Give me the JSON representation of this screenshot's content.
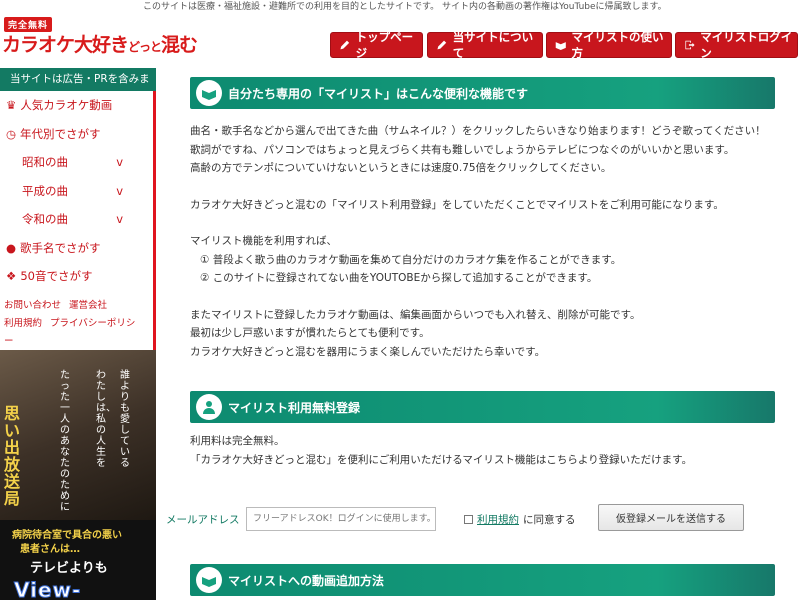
{
  "topnote": "このサイトは医療・福祉施設・避難所での利用を目的としたサイトです。 サイト内の各動画の著作権はYouTubeに帰属致します。",
  "logo": {
    "badge": "完全無料",
    "main": "カラオケ大好き",
    "small": "どっと",
    "tail": "混む"
  },
  "nav": [
    {
      "label": "トップページ",
      "icon": "pen-icon"
    },
    {
      "label": "当サイトについて",
      "icon": "pen-icon"
    },
    {
      "label": "マイリストの使い方",
      "icon": "book-icon"
    },
    {
      "label": "マイリストログイン",
      "icon": "login-icon"
    }
  ],
  "sidebar": {
    "header": "当サイトは広告・PRを含みます",
    "items": [
      {
        "label": "人気カラオケ動画",
        "icon": "crown-icon"
      },
      {
        "label": "年代別でさがす",
        "icon": "clock-icon"
      },
      {
        "label": "昭和の曲",
        "arrow": "v"
      },
      {
        "label": "平成の曲",
        "arrow": "v"
      },
      {
        "label": "令和の曲",
        "arrow": "v"
      },
      {
        "label": "歌手名でさがす",
        "icon": "person-icon"
      },
      {
        "label": "50音でさがす",
        "icon": "speech-icon"
      }
    ],
    "links": [
      "お問い合わせ",
      "運営会社",
      "利用規約",
      "プライバシーポリシー"
    ]
  },
  "ad": {
    "title": "思い出放送局",
    "v1": "たった一人のあなたのために",
    "v2": "わたしは、私の人生を",
    "v3": "誰よりも愛している",
    "t1": "病院待合室で具合の悪い",
    "t2": "患者さんは…",
    "t3": "テレビよりも",
    "t4": "View-TV.Net"
  },
  "main": {
    "sec1_title": "自分たち専用の「マイリスト」はこんな便利な機能です",
    "p1": [
      "曲名・歌手名などから選んで出てきた曲（サムネイル？）をクリックしたらいきなり始まります！どうぞ歌ってください！",
      "歌詞がですね、パソコンではちょっと見えづらく共有も難しいでしょうからテレビにつなぐのがいいかと思います。",
      "高齢の方でテンポについていけないというときには速度0.75倍をクリックしてください。"
    ],
    "p2": "カラオケ大好きどっと混むの「マイリスト利用登録」をしていただくことでマイリストをご利用可能になります。",
    "p3_lead": "マイリスト機能を利用すれば、",
    "p3_items": [
      "① 普段よく歌う曲のカラオケ動画を集めて自分だけのカラオケ集を作ることができます。",
      "② このサイトに登録されてない曲をYOUTOBEから探して追加することができます。"
    ],
    "p4": [
      "またマイリストに登録したカラオケ動画は、編集画面からいつでも入れ替え、削除が可能です。",
      "最初は少し戸惑いますが慣れたらとても便利です。",
      "カラオケ大好きどっと混むを器用にうまく楽しんでいただけたら幸いです。"
    ],
    "sec2_title": "マイリスト利用無料登録",
    "p5": [
      "利用料は完全無料。",
      "「カラオケ大好きどっと混む」を便利にご利用いただけるマイリスト機能はこちらより登録いただけます。"
    ],
    "form": {
      "label": "メールアドレス",
      "placeholder": "フリーアドレスOK！ログインに使用します。",
      "check_link": "利用規約",
      "check_text": "に同意する",
      "button": "仮登録メールを送信する"
    },
    "sec3_title": "マイリストへの動画追加方法"
  },
  "colors": {
    "accent_red": "#c8161d",
    "accent_green": "#16a17f"
  }
}
